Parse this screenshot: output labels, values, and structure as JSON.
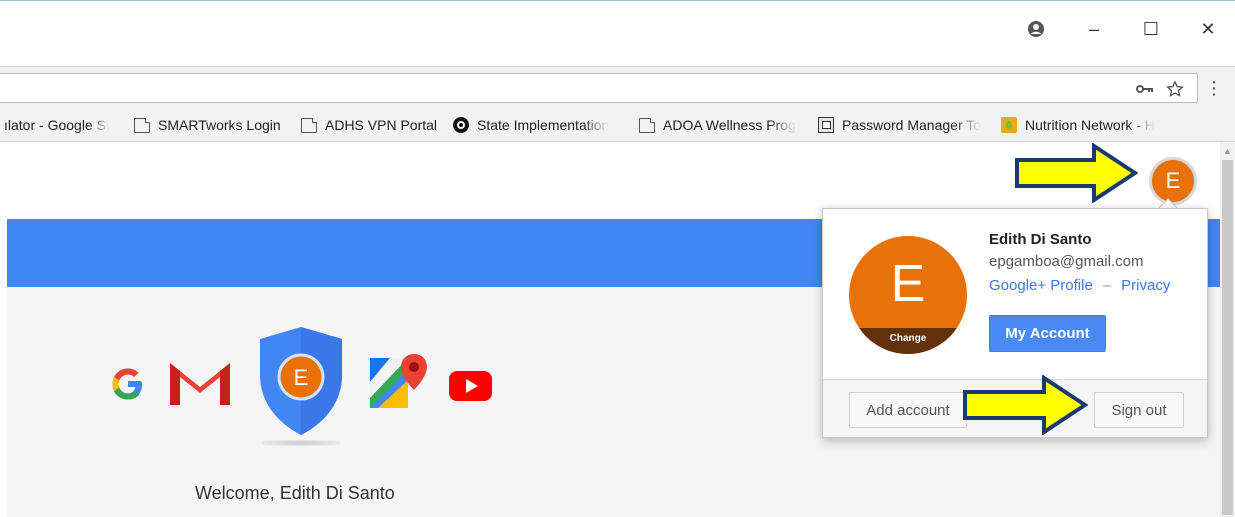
{
  "window": {
    "controls": {
      "user_icon": "account-circle-icon",
      "minimize": "–",
      "maximize": "☐",
      "close": "✕"
    }
  },
  "omnibox": {
    "key_icon": "key-icon",
    "star_icon": "star-icon",
    "menu_icon": "⋮"
  },
  "bookmarks": [
    {
      "label": "ılator - Google Sı",
      "icon": "page-icon"
    },
    {
      "label": "SMARTworks Login",
      "icon": "page-icon"
    },
    {
      "label": "ADHS VPN Portal",
      "icon": "page-icon"
    },
    {
      "label": "State Implementation",
      "icon": "swirl-logo-icon"
    },
    {
      "label": "ADOA Wellness Prog",
      "icon": "page-icon"
    },
    {
      "label": "Password Manager To",
      "icon": "password-manager-icon"
    },
    {
      "label": "Nutrition Network - H",
      "icon": "nutrition-network-icon"
    }
  ],
  "header": {
    "apps_glyph": "∴∴∴",
    "avatar_letter": "E"
  },
  "products": {
    "shield_letter": "E"
  },
  "welcome_text": "Welcome, Edith Di Santo",
  "account_popup": {
    "avatar_letter": "E",
    "change_label": "Change",
    "name": "Edith Di Santo",
    "email": "epgamboa@gmail.com",
    "google_plus_link": "Google+ Profile",
    "separator": "–",
    "privacy_link": "Privacy",
    "my_account_button": "My Account",
    "add_account_button": "Add account",
    "sign_out_button": "Sign out"
  },
  "colors": {
    "google_blue": "#4285f4",
    "avatar_orange": "#e8710a",
    "annotation_arrow_fill": "#ffff00",
    "annotation_arrow_stroke": "#1b3a73"
  }
}
